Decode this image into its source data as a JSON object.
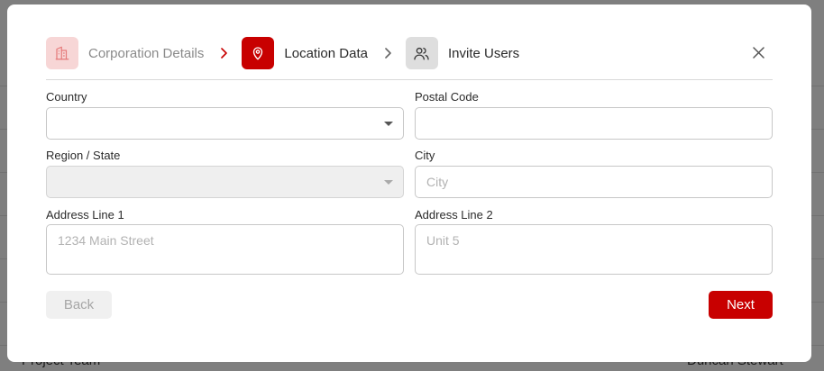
{
  "background": {
    "footer_left": "Project Team",
    "footer_right": "Duncan Stewart"
  },
  "stepper": {
    "steps": [
      {
        "label": "Corporation Details",
        "state": "completed",
        "icon": "building-icon"
      },
      {
        "label": "Location Data",
        "state": "active",
        "icon": "map-pin-icon"
      },
      {
        "label": "Invite Users",
        "state": "pending",
        "icon": "users-icon"
      }
    ]
  },
  "form": {
    "country": {
      "label": "Country",
      "value": ""
    },
    "postal_code": {
      "label": "Postal Code",
      "value": "",
      "placeholder": ""
    },
    "region": {
      "label": "Region / State",
      "value": "",
      "disabled": true
    },
    "city": {
      "label": "City",
      "value": "",
      "placeholder": "City"
    },
    "address1": {
      "label": "Address Line 1",
      "value": "",
      "placeholder": "1234 Main Street"
    },
    "address2": {
      "label": "Address Line 2",
      "value": "",
      "placeholder": "Unit 5"
    }
  },
  "actions": {
    "back_label": "Back",
    "next_label": "Next"
  },
  "colors": {
    "accent": "#c80000",
    "accent_light": "#f7d6d6",
    "pending": "#dedede"
  }
}
